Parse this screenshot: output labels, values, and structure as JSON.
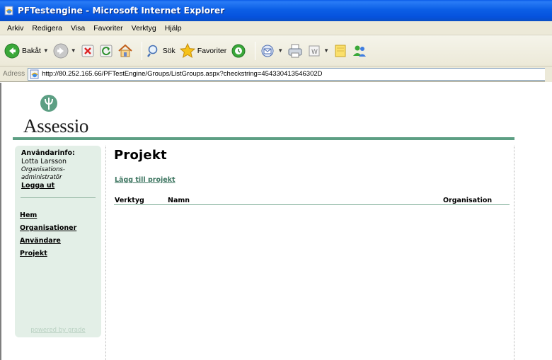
{
  "window": {
    "title": "PFTestengine - Microsoft Internet Explorer"
  },
  "menu": {
    "items": [
      {
        "label": "Arkiv"
      },
      {
        "label": "Redigera"
      },
      {
        "label": "Visa"
      },
      {
        "label": "Favoriter"
      },
      {
        "label": "Verktyg"
      },
      {
        "label": "Hjälp"
      }
    ]
  },
  "toolbar": {
    "back_label": "Bakåt",
    "search_label": "Sök",
    "favorites_label": "Favoriter",
    "icons": [
      "back-icon",
      "forward-icon",
      "stop-icon",
      "refresh-icon",
      "home-icon",
      "search-icon",
      "favorites-icon",
      "history-icon",
      "mail-icon",
      "print-icon",
      "edit-icon",
      "notes-icon",
      "messenger-icon"
    ]
  },
  "address": {
    "label": "Adress",
    "url": "http://80.252.165.66/PFTestEngine/Groups/ListGroups.aspx?checkstring=454330413546302D"
  },
  "page": {
    "logo_text": "Assessio",
    "accent_color": "#5d9f84",
    "sidebar": {
      "user_title": "Användarinfo:",
      "user_name": "Lotta Larsson",
      "user_role_line1": "Organisations-",
      "user_role_line2": "administratör",
      "logout": "Logga ut",
      "nav": [
        {
          "label": "Hem"
        },
        {
          "label": "Organisationer"
        },
        {
          "label": "Användare"
        },
        {
          "label": "Projekt"
        }
      ],
      "powered_by": "powered by grade"
    },
    "main": {
      "title": "Projekt",
      "add_link": "Lägg till projekt",
      "columns": [
        {
          "label": "Verktyg"
        },
        {
          "label": "Namn"
        },
        {
          "label": "Organisation"
        }
      ]
    }
  }
}
